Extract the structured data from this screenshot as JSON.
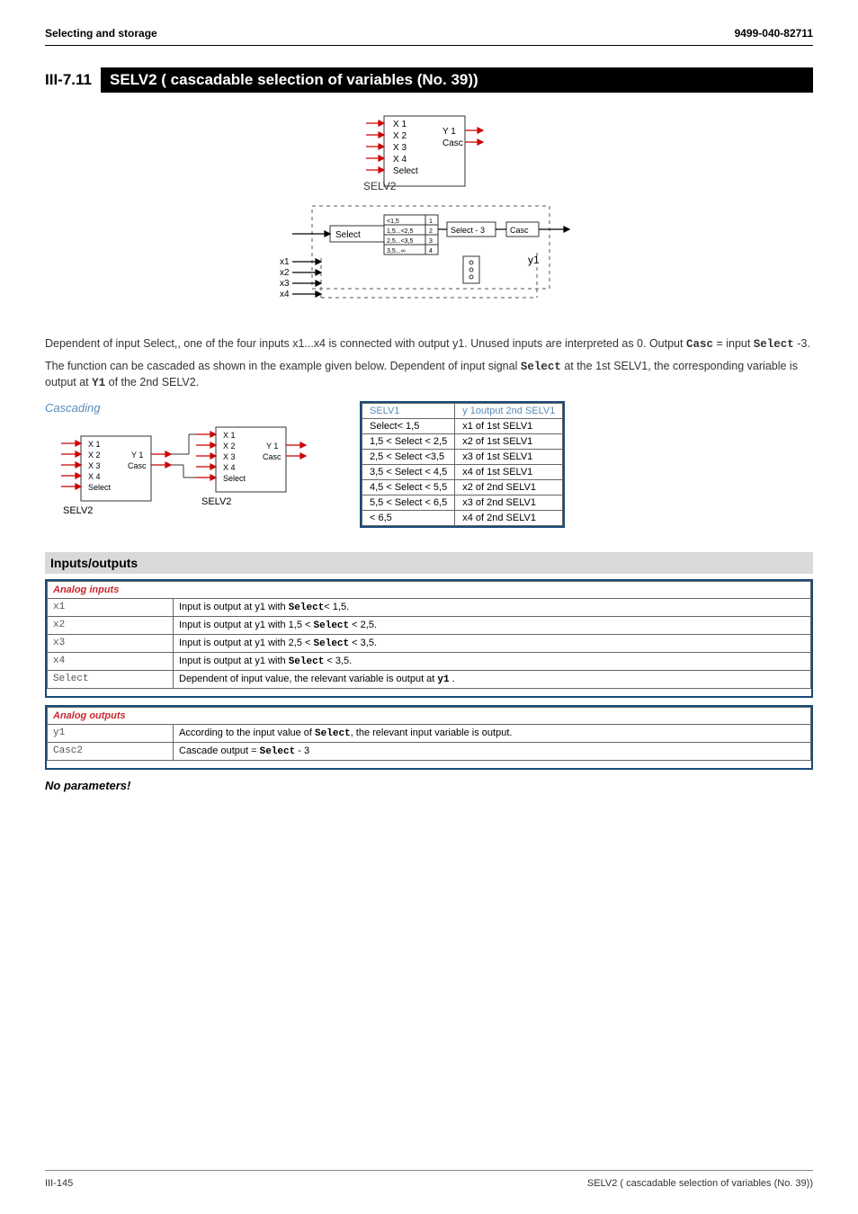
{
  "header": {
    "left": "Selecting and storage",
    "right": "9499-040-82711"
  },
  "section": {
    "num": "III-7.11",
    "title": "SELV2 ( cascadable selection of variables (No. 39))"
  },
  "body1a": "Dependent of input Select,, one of the four inputs x1...x4 is connected with output y1.  Unused inputs are interpreted as 0. Output ",
  "body1_m1": "Casc",
  "body1b": " = input ",
  "body1_m2": "Select",
  "body1c": "  -3.",
  "body2a": "The function can be cascaded as shown in the example given below. Dependent of input signal ",
  "body2_m1": "Select",
  "body2b": " at the 1st SELV1, the corresponding variable is output at ",
  "body2_m2": "Y1",
  "body2c": " of the 2nd SELV2.",
  "cascading_label": "Cascading",
  "selv_table": {
    "head": [
      "SELV1",
      "y 1output 2nd SELV1"
    ],
    "rows": [
      [
        "Select< 1,5",
        "x1 of 1st SELV1"
      ],
      [
        "1,5 <  Select < 2,5",
        "x2 of 1st SELV1"
      ],
      [
        "2,5 <  Select <3,5",
        "x3 of 1st SELV1"
      ],
      [
        "3,5 <  Select < 4,5",
        "x4 of 1st SELV1"
      ],
      [
        "4,5 <  Select < 5,5",
        "x2 of 2nd SELV1"
      ],
      [
        "5,5 <  Select < 6,5",
        "x3 of 2nd SELV1"
      ],
      [
        "< 6,5",
        "x4 of 2nd SELV1"
      ]
    ]
  },
  "io_heading": "Inputs/outputs",
  "analog_inputs": {
    "title": "Analog inputs",
    "rows": [
      {
        "lbl": "x1",
        "txt_a": "Input is output at y1 with ",
        "m": "Select",
        "txt_b": "< 1,5."
      },
      {
        "lbl": "x2",
        "txt_a": "Input is output at y1 with 1,5 <  ",
        "m": "Select",
        "txt_b": " < 2,5."
      },
      {
        "lbl": "x3",
        "txt_a": "Input is output at y1 with 2,5 <  ",
        "m": "Select",
        "txt_b": " < 3,5."
      },
      {
        "lbl": "x4",
        "txt_a": "Input is output at y1 with ",
        "m": "Select",
        "txt_b": " < 3,5."
      },
      {
        "lbl": "Select",
        "txt_a": "Dependent of input value, the relevant variable is output at ",
        "m": "y1",
        "txt_b": " ."
      }
    ]
  },
  "analog_outputs": {
    "title": "Analog outputs",
    "rows": [
      {
        "lbl": "y1",
        "txt_a": "According to the input value of ",
        "m": "Select",
        "txt_b": ", the relevant input variable is output."
      },
      {
        "lbl": "Casc2",
        "txt_a": "Cascade output =  ",
        "m": "Select",
        "txt_b": " - 3"
      }
    ]
  },
  "noparams": "No parameters!",
  "footer": {
    "left": "III-145",
    "right": "SELV2 ( cascadable selection of variables (No. 39))"
  },
  "diagram": {
    "block_label": "SELV2",
    "inputs": [
      "X 1",
      "X 2",
      "X 3",
      "X 4",
      "Select"
    ],
    "outputs": [
      "Y 1",
      "Casc"
    ],
    "lower": {
      "select_label": "Select",
      "tiny": [
        "<1,5",
        "1,5...<2,5",
        "2,5...<3,5",
        "3,5...∞"
      ],
      "tiny_right": [
        "1",
        "2",
        "3",
        "4"
      ],
      "minus3": "Select - 3",
      "casc": "Casc",
      "x_labels": [
        "x1",
        "x2",
        "x3",
        "x4"
      ],
      "y_label": "y1"
    }
  },
  "cascading_diagram": {
    "block_label": "SELV2",
    "inputs": [
      "X 1",
      "X 2",
      "X 3",
      "X 4",
      "Select"
    ],
    "outputs": [
      "Y 1",
      "Casc"
    ]
  }
}
